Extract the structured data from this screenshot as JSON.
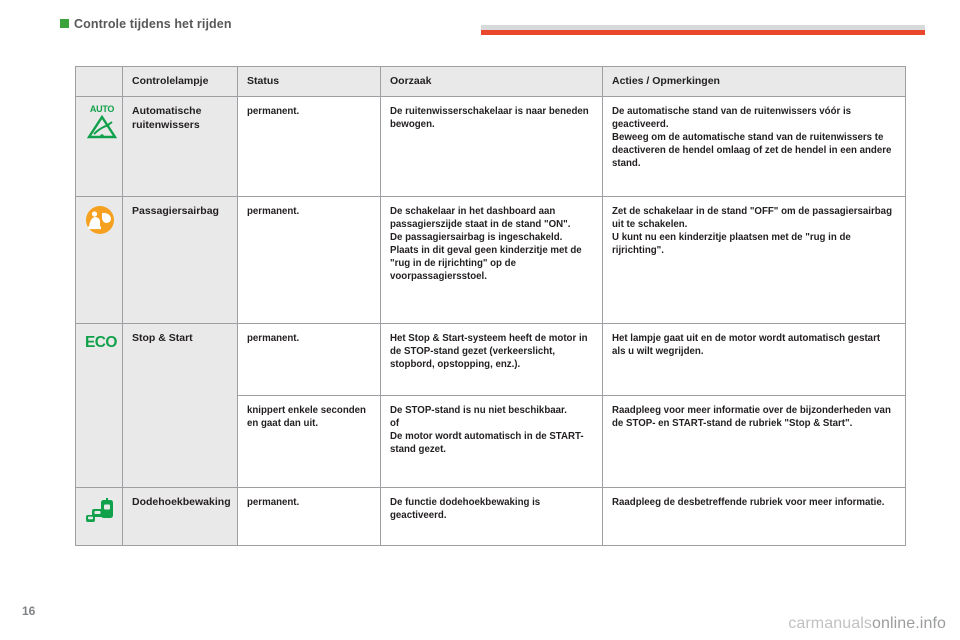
{
  "header": {
    "title": "Controle tijdens het rijden",
    "marker_color": "#3aa33a",
    "rule_color": "#e8472b"
  },
  "table": {
    "columns": [
      "",
      "Controlelampje",
      "Status",
      "Oorzaak",
      "Acties / Opmerkingen"
    ],
    "rows": [
      {
        "icon": "auto-wiper-icon",
        "icon_label": "AUTO",
        "icon_color": "#12a14b",
        "name": "Automatische ruitenwissers",
        "status": "permanent.",
        "cause": "De ruitenwisserschakelaar is naar beneden bewogen.",
        "action_1": "De automatische stand van de ruitenwissers vóór is geactiveerd.",
        "action_2": "Beweeg om de automatische stand van de ruitenwissers te deactiveren de hendel omlaag of zet de hendel in een andere stand."
      },
      {
        "icon": "passenger-airbag-icon",
        "icon_color": "#f5a01e",
        "name": "Passagiersairbag",
        "status": "permanent.",
        "cause_1": "De schakelaar in het dashboard aan passagierszijde staat in de stand \"ON\".",
        "cause_2": "De passagiersairbag is ingeschakeld. Plaats in dit geval geen kinderzitje met de \"rug in de rijrichting\" op de voorpassagiersstoel.",
        "action_1": "Zet de schakelaar in de stand \"OFF\" om de passagiersairbag uit te schakelen.",
        "action_2": "U kunt nu een kinderzitje plaatsen met de \"rug in de rijrichting\"."
      },
      {
        "icon": "eco-icon",
        "icon_label": "ECO",
        "icon_color": "#12a14b",
        "name": "Stop & Start",
        "status": "permanent.",
        "cause": "Het Stop & Start-systeem heeft de motor in de STOP-stand gezet (verkeerslicht, stopbord, opstopping, enz.).",
        "action": "Het lampje gaat uit en de motor wordt automatisch gestart als u wilt wegrijden."
      },
      {
        "status": "knippert enkele seconden en gaat dan uit.",
        "cause_1": "De STOP-stand is nu niet beschikbaar.",
        "cause_2": "of",
        "cause_3": "De motor wordt automatisch in de START-stand gezet.",
        "action": "Raadpleeg voor meer informatie over de bijzonderheden van de STOP- en START-stand de rubriek \"Stop & Start\"."
      },
      {
        "icon": "blind-spot-monitoring-icon",
        "icon_color": "#12a14b",
        "name": "Dodehoekbewaking",
        "status": "permanent.",
        "cause": "De functie dodehoekbewaking is geactiveerd.",
        "action": "Raadpleeg de desbetreffende rubriek voor meer informatie."
      }
    ]
  },
  "footer": {
    "page_number": "16",
    "watermark_light": "carmanuals",
    "watermark_dark": "online.info"
  }
}
